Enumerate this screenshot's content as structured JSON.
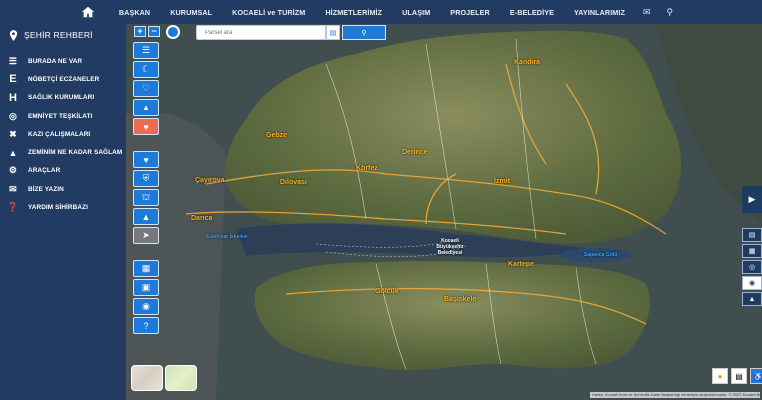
{
  "topnav": {
    "home_icon": "home-icon",
    "items": [
      "BAŞKAN",
      "KURUMSAL",
      "KOCAELİ ve TURİZM",
      "HİZMETLERİMİZ",
      "ULAŞIM",
      "PROJELER",
      "E-BELEDİYE",
      "YAYINLARIMIZ"
    ],
    "extra_icons": [
      "envelope-icon",
      "search-icon"
    ]
  },
  "sidebar": {
    "title": "ŞEHİR REHBERİ",
    "items": [
      {
        "label": "BURADA NE VAR",
        "icon": "list-icon"
      },
      {
        "label": "NÖBETÇİ ECZANELER",
        "icon": "pharmacy-icon"
      },
      {
        "label": "SAĞLIK KURUMLARI",
        "icon": "hospital-icon"
      },
      {
        "label": "EMNİYET TEŞKİLATI",
        "icon": "police-icon"
      },
      {
        "label": "KAZI ÇALIŞMALARI",
        "icon": "excavation-icon"
      },
      {
        "label": "ZEMİNİM NE KADAR SAĞLAM",
        "icon": "ground-icon"
      },
      {
        "label": "ARAÇLAR",
        "icon": "tools-icon"
      },
      {
        "label": "BİZE YAZIN",
        "icon": "chat-icon"
      },
      {
        "label": "YARDIM SİHİRBAZI",
        "icon": "help-icon"
      }
    ]
  },
  "search": {
    "placeholder": "Parsel ara"
  },
  "map": {
    "cities": [
      {
        "name": "Kandıra",
        "style": "orange"
      },
      {
        "name": "Gebze",
        "style": "orange"
      },
      {
        "name": "Derince",
        "style": "orange"
      },
      {
        "name": "Çayırova",
        "style": "orange"
      },
      {
        "name": "Dilovası",
        "style": "orange"
      },
      {
        "name": "Körfez",
        "style": "orange"
      },
      {
        "name": "İzmit",
        "style": "orange"
      },
      {
        "name": "Darıca",
        "style": "orange"
      },
      {
        "name": "Kartepe",
        "style": "orange"
      },
      {
        "name": "Gölcük",
        "style": "orange"
      },
      {
        "name": "Başiskele",
        "style": "orange"
      },
      {
        "name": "Kocaeli Büyükşehir Belediyesi",
        "style": "white"
      },
      {
        "name": "Eskihisar İskelesi",
        "style": "blue"
      },
      {
        "name": "Sapanca Gölü",
        "style": "blue"
      }
    ],
    "attribution": "Harita, Kocaeli İmar ve Şehircilik Daire Başkanlığı verileriyle oluşturulmuştur. © 2022 Kocaeli Büyükşehir Belediyesi"
  },
  "colors": {
    "nav_bg": "#223b63",
    "tool_blue": "#1e7ad9",
    "heart_red": "#ef6a4e",
    "city_label": "#f7b120"
  }
}
